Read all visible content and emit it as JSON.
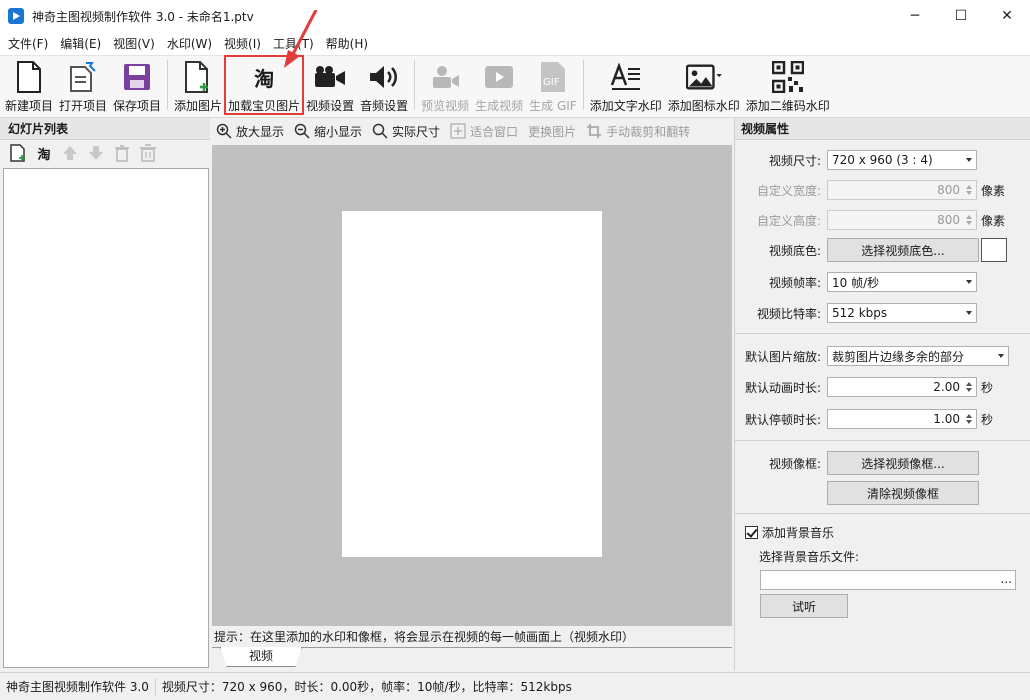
{
  "window": {
    "title": "神奇主图视频制作软件 3.0 - 未命名1.ptv",
    "minimize": "─",
    "maximize": "☐",
    "close": "✕"
  },
  "menu": [
    "文件(F)",
    "编辑(E)",
    "视图(V)",
    "水印(W)",
    "视频(I)",
    "工具(T)",
    "帮助(H)"
  ],
  "toolbar": {
    "new_project": "新建项目",
    "open_project": "打开项目",
    "save_project": "保存项目",
    "add_image": "添加图片",
    "load_taobao": "加载宝贝图片",
    "taobao_glyph": "淘",
    "video_settings": "视频设置",
    "audio_settings": "音频设置",
    "preview_video": "预览视频",
    "generate_video": "生成视频",
    "generate_gif": "生成 GIF",
    "gif_glyph": "GIF",
    "add_text_watermark": "添加文字水印",
    "add_icon_watermark": "添加图标水印",
    "add_qr_watermark": "添加二维码水印"
  },
  "left_panel": {
    "title": "幻灯片列表",
    "taobao_glyph": "淘"
  },
  "center": {
    "zoom_in": "放大显示",
    "zoom_out": "缩小显示",
    "actual_size": "实际尺寸",
    "fit_window": "适合窗口",
    "replace_image": "更换图片",
    "manual_crop": "手动裁剪和翻转",
    "hint": "提示：在这里添加的水印和像框，将会显示在视频的每一帧画面上（视频水印）",
    "tab_video": "视频"
  },
  "properties": {
    "title": "视频属性",
    "video_size_label": "视频尺寸:",
    "video_size_value": "720 x 960   (3 : 4)",
    "custom_width_label": "自定义宽度:",
    "custom_width_value": "800",
    "custom_height_label": "自定义高度:",
    "custom_height_value": "800",
    "pixel_unit": "像素",
    "bg_color_label": "视频底色:",
    "bg_color_button": "选择视频底色...",
    "bg_color": "#ffffff",
    "frame_rate_label": "视频帧率:",
    "frame_rate_value": "10 帧/秒",
    "bitrate_label": "视频比特率:",
    "bitrate_value": "512 kbps",
    "image_scale_label": "默认图片缩放:",
    "image_scale_value": "裁剪图片边缘多余的部分",
    "anim_duration_label": "默认动画时长:",
    "anim_duration_value": "2.00",
    "pause_duration_label": "默认停顿时长:",
    "pause_duration_value": "1.00",
    "seconds_unit": "秒",
    "frame_label": "视频像框:",
    "choose_frame_button": "选择视频像框...",
    "clear_frame_button": "清除视频像框",
    "bg_music_label": "添加背景音乐",
    "bg_music_checked": true,
    "bg_music_file_label": "选择背景音乐文件:",
    "bg_music_file_value": "",
    "browse": "...",
    "listen_button": "试听"
  },
  "status": {
    "app": "神奇主图视频制作软件 3.0",
    "info": "视频尺寸：720 x 960，时长：0.00秒，帧率：10帧/秒，比特率：512kbps"
  },
  "colors": {
    "accent": "#1976d2",
    "highlight": "#e23b3b",
    "save_purple": "#7b3f9e"
  }
}
